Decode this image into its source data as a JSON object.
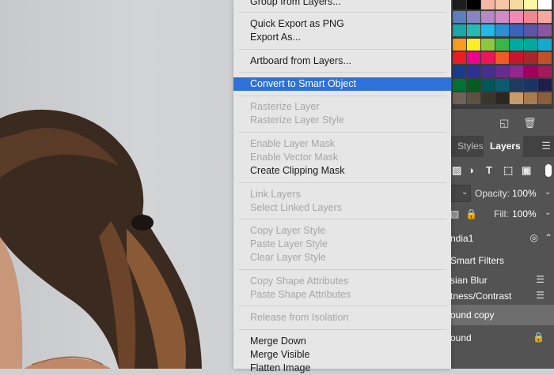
{
  "context_menu": {
    "items": [
      {
        "label": "Group from Layers...",
        "enabled": true
      },
      {
        "label": "Quick Export as PNG",
        "enabled": true
      },
      {
        "label": "Export As...",
        "enabled": true
      },
      {
        "label": "Artboard from Layers...",
        "enabled": true
      },
      {
        "label": "Convert to Smart Object",
        "enabled": true,
        "highlighted": true
      },
      {
        "label": "Rasterize Layer",
        "enabled": false
      },
      {
        "label": "Rasterize Layer Style",
        "enabled": false
      },
      {
        "label": "Enable Layer Mask",
        "enabled": false
      },
      {
        "label": "Enable Vector Mask",
        "enabled": false
      },
      {
        "label": "Create Clipping Mask",
        "enabled": true
      },
      {
        "label": "Link Layers",
        "enabled": false
      },
      {
        "label": "Select Linked Layers",
        "enabled": false
      },
      {
        "label": "Copy Layer Style",
        "enabled": false
      },
      {
        "label": "Paste Layer Style",
        "enabled": false
      },
      {
        "label": "Clear Layer Style",
        "enabled": false
      },
      {
        "label": "Copy Shape Attributes",
        "enabled": false
      },
      {
        "label": "Paste Shape Attributes",
        "enabled": false
      },
      {
        "label": "Release from Isolation",
        "enabled": false
      },
      {
        "label": "Merge Down",
        "enabled": true
      },
      {
        "label": "Merge Visible",
        "enabled": true
      },
      {
        "label": "Flatten Image",
        "enabled": true
      }
    ]
  },
  "layers_panel": {
    "tabs": [
      {
        "label": "Styles",
        "active": false
      },
      {
        "label": "Layers",
        "active": true
      }
    ],
    "opacity_label": "Opacity:",
    "opacity_value": "100%",
    "fill_label": "Fill:",
    "fill_value": "100%",
    "layers": [
      {
        "name": "ndia1",
        "icon": "smart-object-icon"
      },
      {
        "name": "Smart Filters",
        "icon": ""
      },
      {
        "name": "sian Blur",
        "icon": "filter-options-icon"
      },
      {
        "name": "tness/Contrast",
        "icon": "filter-options-icon"
      },
      {
        "name": "ound copy",
        "icon": "",
        "selected": true
      },
      {
        "name": "ound",
        "icon": "lock-icon"
      }
    ]
  },
  "swatch_colors": [
    [
      "#1d1d1d",
      "#000000",
      "#f6b7a7",
      "#f7c5a8",
      "#f4d9a3",
      "#fbf6a8",
      "#ffffff"
    ],
    [
      "#5c7fbf",
      "#8a83c3",
      "#b589c4",
      "#cf8dc3",
      "#f18ab5",
      "#f18891",
      "#f7a99f"
    ],
    [
      "#19a9a7",
      "#22bcb4",
      "#21b9e7",
      "#2a8fd4",
      "#3a64b9",
      "#5a55a8",
      "#8c55a3"
    ],
    [
      "#f79b1c",
      "#fcee21",
      "#8dc63f",
      "#39b54a",
      "#00a99d",
      "#00a99d",
      "#15a9d1"
    ],
    [
      "#ec1c24",
      "#ec008c",
      "#ed145b",
      "#f15a24",
      "#c4162c",
      "#a6262a",
      "#c25027"
    ],
    [
      "#1a3c8c",
      "#2e3192",
      "#452f8f",
      "#662d91",
      "#92278f",
      "#9e005d",
      "#a3195b"
    ],
    [
      "#007236",
      "#005e20",
      "#00585a",
      "#0b5c71",
      "#1f3a5f",
      "#193363",
      "#1e1e4c"
    ],
    [
      "#6e6356",
      "#5d5242",
      "#3b352c",
      "#2b2622",
      "#c69c6d",
      "#a87a4e",
      "#8b5e3c"
    ]
  ]
}
